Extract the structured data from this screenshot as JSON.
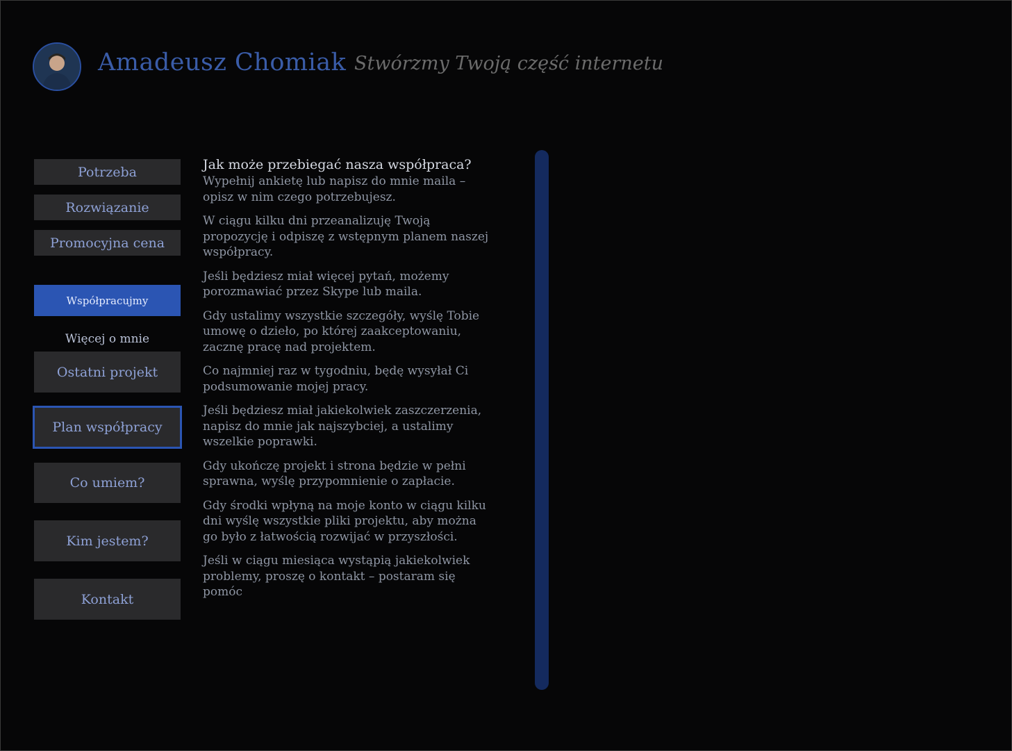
{
  "header": {
    "name": "Amadeusz Chomiak",
    "tagline": "Stwórzmy Twoją część internetu"
  },
  "nav": {
    "potrzeba": "Potrzeba",
    "rozwiazanie": "Rozwiązanie",
    "promocyjna": "Promocyjna cena",
    "wspolpracujmy": "Współpracujmy",
    "wiecej": "Więcej o mnie",
    "ostatni": "Ostatni projekt",
    "plan": "Plan współpracy",
    "umiem": "Co umiem?",
    "kim": "Kim jestem?",
    "kontakt": "Kontakt"
  },
  "content": {
    "heading": "Jak może przebiegać nasza współpraca?",
    "paragraphs": [
      "Wypełnij ankietę lub napisz do mnie maila – opisz w nim czego potrzebujesz.",
      "W ciągu kilku dni przeanalizuję Twoją propozycję i odpiszę z wstępnym planem naszej współpracy.",
      "Jeśli będziesz miał więcej pytań, możemy porozmawiać przez Skype lub maila.",
      "Gdy ustalimy wszystkie szczegóły, wyślę Tobie umowę o dzieło, po której zaakceptowaniu, zacznę pracę nad projektem.",
      "Co najmniej raz w tygodniu, będę wysyłał Ci podsumowanie mojej pracy.",
      "Jeśli będziesz miał jakiekolwiek zaszczerzenia, napisz do mnie jak najszybciej, a ustalimy wszelkie poprawki.",
      "Gdy ukończę projekt i strona będzie w pełni sprawna, wyślę przypomnienie o zapłacie.",
      "Gdy środki wpłyną na moje konto w ciągu kilku dni wyślę wszystkie pliki projektu, aby można go było z łatwością rozwijać w przyszłości.",
      "Jeśli w ciągu miesiąca wystąpią jakiekolwiek problemy, proszę o kontakt – postaram się pomóc"
    ]
  },
  "colors": {
    "accent": "#2b55b3",
    "nav_bg": "#2a2a2c",
    "scrollbar": "#142a5e"
  }
}
